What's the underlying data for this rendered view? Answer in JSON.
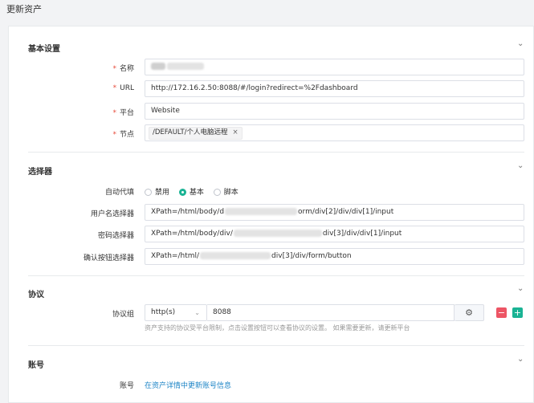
{
  "page": {
    "title": "更新资产"
  },
  "basic": {
    "title": "基本设置",
    "name_label": "名称",
    "url_label": "URL",
    "url_value": "http://172.16.2.50:8088/#/login?redirect=%2Fdashboard",
    "platform_label": "平台",
    "platform_value": "Website",
    "node_label": "节点",
    "node_tag": "/DEFAULT/个人电脑远程",
    "node_tag_remove": "×"
  },
  "selector": {
    "title": "选择器",
    "autofill_label": "自动代填",
    "options": [
      "禁用",
      "基本",
      "脚本"
    ],
    "selected": "基本",
    "username_label": "用户名选择器",
    "username_prefix": "XPath=/html/body/d",
    "username_suffix": "orm/div[2]/div/div[1]/input",
    "password_label": "密码选择器",
    "password_prefix": "XPath=/html/body/div/",
    "password_suffix": "div[3]/div/div[1]/input",
    "confirm_label": "确认按钮选择器",
    "confirm_prefix": "XPath=/html/",
    "confirm_suffix": "div[3]/div/form/button"
  },
  "protocol": {
    "title": "协议",
    "group_label": "协议组",
    "protocol_select": "http(s)",
    "port": "8088",
    "remove_btn": "−",
    "add_btn": "+",
    "hint": "资产支持的协议受平台限制，点击设置按钮可以查看协议的设置。 如果需要更新，请更新平台"
  },
  "account": {
    "title": "账号",
    "label": "账号",
    "link": "在资产详情中更新账号信息"
  },
  "colors": {
    "accent": "#1ab394",
    "danger": "#ed5565",
    "link": "#1c84c6"
  },
  "icons": {
    "collapse": "chevron-down-icon",
    "settings": "gear-icon"
  }
}
